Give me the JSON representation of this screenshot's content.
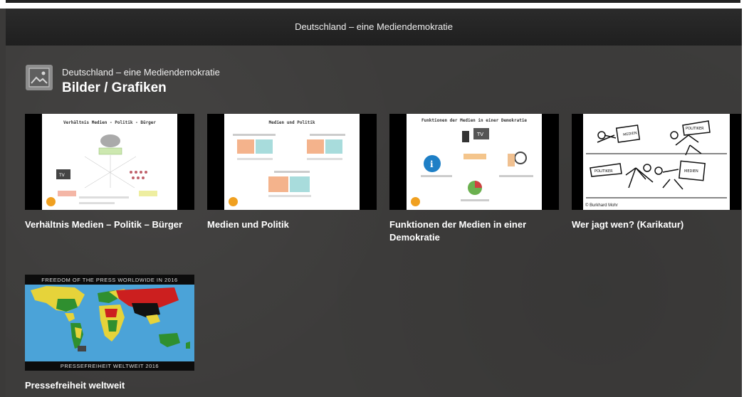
{
  "header": {
    "title": "Deutschland – eine Mediendemokratie"
  },
  "section": {
    "subtitle": "Deutschland – eine Mediendemokratie",
    "title": "Bilder / Grafiken"
  },
  "cards": [
    {
      "label": "Verhältnis Medien – Politik – Bürger",
      "slide_title": "Verhältnis Medien - Politik - Bürger"
    },
    {
      "label": "Medien und Politik",
      "slide_title": "Medien und Politik"
    },
    {
      "label": "Funktionen der Medien in einer Demokratie",
      "slide_title": "Funktionen der Medien in einer Demokratie"
    },
    {
      "label": "Wer jagt wen? (Karikatur)",
      "credit": "© Burkhard Mohr"
    },
    {
      "label": "Pressefreiheit weltweit",
      "map_top": "FREEDOM OF THE PRESS WORLDWIDE IN 2016",
      "map_bottom": "PRESSEFREIHEIT WELTWEIT 2016"
    }
  ]
}
